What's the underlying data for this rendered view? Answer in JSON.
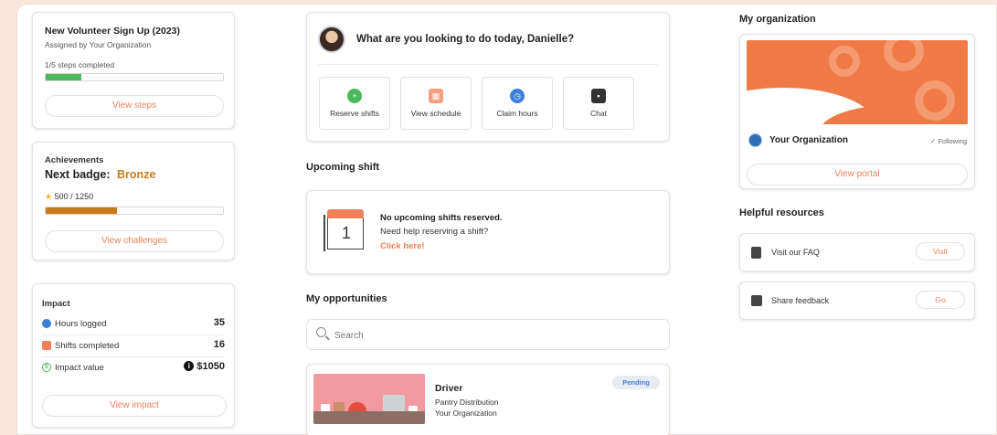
{
  "signup": {
    "title": "New Volunteer Sign Up (2023)",
    "assigned": "Assigned by Your Organization",
    "steps": "1/5 steps completed",
    "progress": 0.2,
    "button": "View steps"
  },
  "achievements": {
    "heading": "Achievements",
    "next_badge_label": "Next badge:",
    "next_badge_value": "Bronze",
    "points": "500 / 1250",
    "progress": 0.4,
    "button": "View challenges"
  },
  "impact": {
    "heading": "Impact",
    "rows": [
      {
        "label": "Hours logged",
        "value": "35"
      },
      {
        "label": "Shifts completed",
        "value": "16"
      },
      {
        "label": "Impact value",
        "value": "$1050"
      }
    ],
    "button": "View impact"
  },
  "greeting": {
    "text": "What are you looking to do today, Danielle?",
    "actions": [
      {
        "label": "Reserve shifts"
      },
      {
        "label": "View schedule"
      },
      {
        "label": "Claim hours"
      },
      {
        "label": "Chat"
      }
    ]
  },
  "upcoming": {
    "heading": "Upcoming shift",
    "calendar_day": "1",
    "empty_title": "No upcoming shifts reserved.",
    "help": "Need help reserving a shift?",
    "link": "Click here!"
  },
  "opportunities": {
    "heading": "My opportunities",
    "search_placeholder": "Search",
    "items": [
      {
        "title": "Driver",
        "line1": "Pantry Distribution",
        "line2": "Your Organization",
        "status": "Pending"
      }
    ]
  },
  "organization": {
    "heading": "My organization",
    "name": "Your Organization",
    "following": "Following",
    "button": "View portal"
  },
  "resources": {
    "heading": "Helpful resources",
    "items": [
      {
        "label": "Visit our FAQ",
        "action": "Visit"
      },
      {
        "label": "Share feedback",
        "action": "Go"
      }
    ]
  },
  "colors": {
    "accent": "#f0805a",
    "green": "#4bb85c",
    "bronze": "#c87a1e",
    "blue": "#3d7fd8"
  }
}
